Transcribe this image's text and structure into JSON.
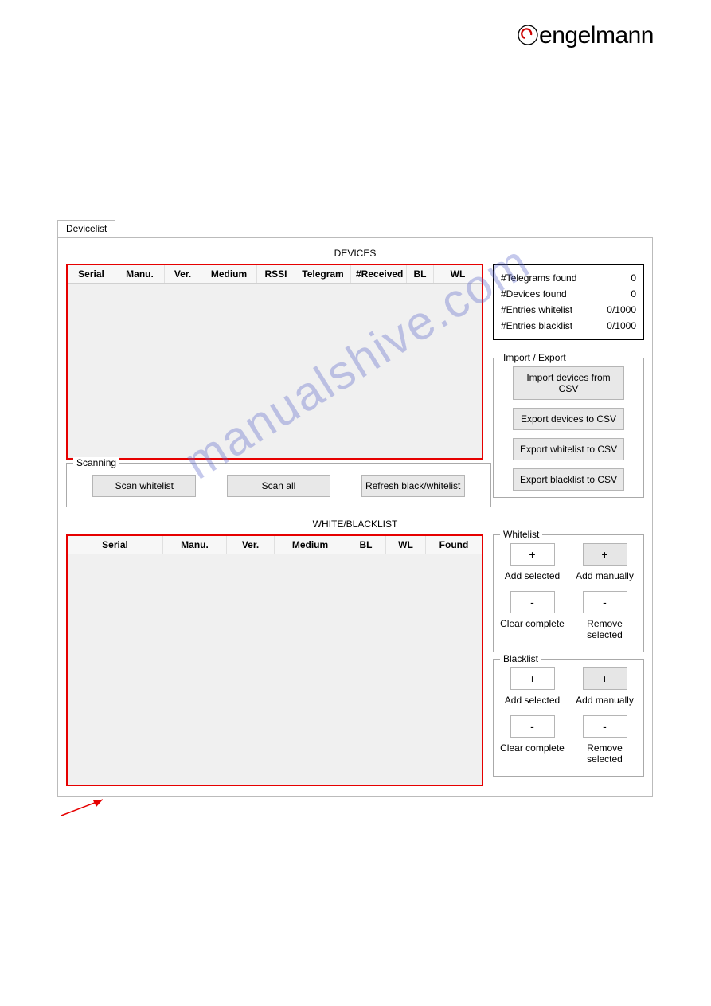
{
  "brand": "engelmann",
  "watermark": "manualshive.com",
  "tab_label": "Devicelist",
  "devices_title": "DEVICES",
  "wb_title": "WHITE/BLACKLIST",
  "devices_columns": [
    "Serial",
    "Manu.",
    "Ver.",
    "Medium",
    "RSSI",
    "Telegram",
    "#Received",
    "BL",
    "WL"
  ],
  "wb_columns": [
    "Serial",
    "Manu.",
    "Ver.",
    "Medium",
    "BL",
    "WL",
    "Found"
  ],
  "stats": {
    "telegrams_label": "#Telegrams found",
    "telegrams_value": "0",
    "devices_label": "#Devices found",
    "devices_value": "0",
    "wl_label": "#Entries whitelist",
    "wl_value": "0/1000",
    "bl_label": "#Entries blacklist",
    "bl_value": "0/1000"
  },
  "import_export": {
    "legend": "Import / Export",
    "import_csv": "Import devices from CSV",
    "export_csv": "Export devices to CSV",
    "export_wl": "Export whitelist to CSV",
    "export_bl": "Export blacklist to CSV"
  },
  "scanning": {
    "legend": "Scanning",
    "scan_wl": "Scan whitelist",
    "scan_all": "Scan all",
    "refresh": "Refresh black/whitelist"
  },
  "whitelist": {
    "legend": "Whitelist",
    "add_selected": "Add selected",
    "add_manually": "Add manually",
    "clear": "Clear complete",
    "remove": "Remove selected",
    "plus": "+",
    "minus": "-"
  },
  "blacklist": {
    "legend": "Blacklist",
    "add_selected": "Add selected",
    "add_manually": "Add manually",
    "clear": "Clear complete",
    "remove": "Remove selected",
    "plus": "+",
    "minus": "-"
  }
}
